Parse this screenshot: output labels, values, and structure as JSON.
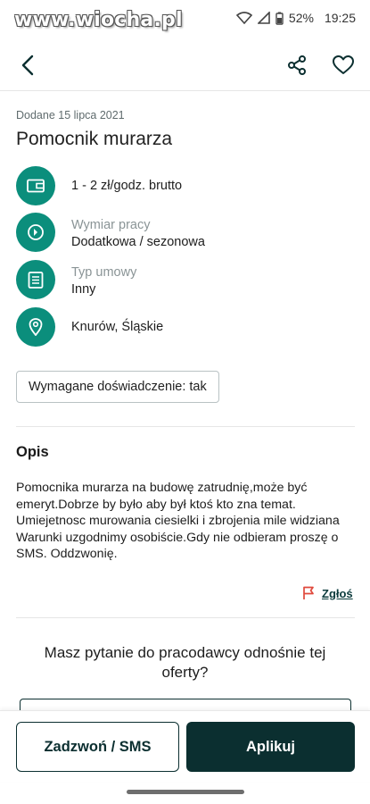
{
  "status_bar": {
    "watermark": "www.wiocha.pl",
    "battery": "52%",
    "time": "19:25"
  },
  "app_bar": {
    "back_icon": "back-arrow-icon",
    "share_icon": "share-icon",
    "favorite_icon": "heart-icon"
  },
  "offer": {
    "date_added": "Dodane 15 lipca 2021",
    "title": "Pomocnik murarza",
    "details": [
      {
        "icon": "wallet-icon",
        "label": "",
        "value": "1 - 2 zł/godz. brutto"
      },
      {
        "icon": "clock-icon",
        "label": "Wymiar pracy",
        "value": "Dodatkowa / sezonowa"
      },
      {
        "icon": "contract-icon",
        "label": "Typ umowy",
        "value": "Inny"
      },
      {
        "icon": "location-pin-icon",
        "label": "",
        "value": "Knurów, Śląskie"
      }
    ],
    "experience_badge": "Wymagane doświadczenie: tak"
  },
  "description": {
    "heading": "Opis",
    "text": "Pomocnika murarza na budowę zatrudnię,może być emeryt.Dobrze by było aby był ktoś kto zna temat. Umiejetnosc murowania ciesielki i zbrojenia mile widziana Warunki uzgodnimy osobiście.Gdy nie odbieram proszę o SMS. Oddzwonię."
  },
  "report": {
    "label": "Zgłoś",
    "icon": "flag-icon"
  },
  "question": {
    "text": "Masz pytanie do pracodawcy odnośnie tej oferty?"
  },
  "actions": {
    "call_label": "Zadzwoń / SMS",
    "apply_label": "Aplikuj"
  },
  "colors": {
    "accent_teal": "#0b8e7c",
    "dark_green": "#0b2f30",
    "report_red": "#e0493c"
  }
}
